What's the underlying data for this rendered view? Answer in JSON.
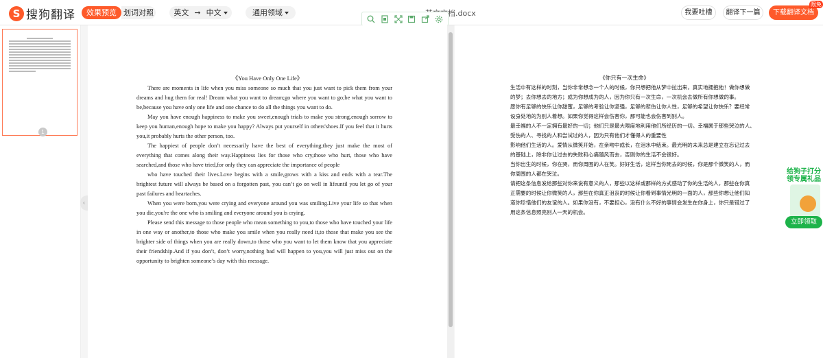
{
  "header": {
    "logo_text": "搜狗翻译",
    "tab_preview": "效果预览",
    "tab_compare": "划词对照",
    "source_lang": "英文",
    "target_lang": "中文",
    "domain_select": "通用领域",
    "file_name": "英文文档.docx",
    "feedback_button": "我要吐槽",
    "next_button": "翻译下一篇",
    "download_button": "下载翻译文档",
    "free_badge": "限免"
  },
  "toolbar_icons": [
    "zoom-icon",
    "fit-page-icon",
    "fullscreen-icon",
    "save-icon",
    "export-icon",
    "settings-icon"
  ],
  "thumbnails": {
    "page_number": "1"
  },
  "source_doc": {
    "title": "《You Have Only One Life》",
    "paragraphs": [
      "There are moments in life when you miss someone so much that you just want to pick them from your dreams and hug them for real! Dream what you want to dream;go where you want to go;be what you want to be,because you have only one life and one chance to do all the things you want to do.",
      "May you have enough happiness to make you sweet,enough trials to make you strong,enough sorrow to keep you human,enough hope to make you happy? Always put yourself in others'shoes.If you feel that it hurts you,it probably hurts the other person, too.",
      "The happiest of people don’t necessarily have the best of everything;they just make the most of everything that comes along their way.Happiness lies for those who cry,those who hurt, those who have searched,and those who have tried,for only they can appreciate the importance of people",
      "who have touched their lives.Love begins with a smile,grows with a kiss and ends with a tear.The brightest future will always be based on a forgotten past, you can’t go on well in lifeuntil you let go of your past failures and heartaches.",
      "When you were born,you were crying and everyone around you was smiling.Live your life so that when you die,you're the one who is smiling and everyone around you is crying.",
      "Please send this message to those people who mean something to you,to those who have touched your life in one way or another,to those who make you smile when you really need it,to those that make you see the brighter side of things when you are really down,to those who you want to let them know that you appreciate their friendship.And if you don’t, don’t worry,nothing bad will happen to you,you will just miss out on the opportunity to brighten someone’s day with this message."
    ]
  },
  "target_doc": {
    "title": "《你只有一次生命》",
    "lines": [
      "生活中有这样的时刻，当你非常想念一个人的时候，你只想把他从梦中拉出来，真实地拥抱他！做你想做",
      "的梦；去你想去的地方；成为你想成为的人，因为你只有一次生命，一次机会去做所有你想做的事。",
      "愿你有足够的快乐让你甜蜜，足够的考验让你坚强，足够的悲伤让你人性，足够的希望让你快乐？要经常",
      "设身处地的为别人着想。如果你觉得这样会伤害你，那可能也会伤害到别人。",
      "最幸福的人不一定拥有最好的一切；他们只是最大限度地利用他们所经历的一切。幸福属于那些哭泣的人、",
      "受伤的人、寻找的人和尝试过的人，因为只有他们才懂得人的重要性",
      "影响他们生活的人。爱情从微笑开始，在亲吻中成长，在泪水中结束。最光明的未来总是建立在忘记过去",
      "的基础上，除非你让过去的失败和心痛随风而去，否则你的生活不会很好。",
      "当你出生的时候，你在哭，而你周围的人在笑。好好生活，这样当你死去的时候，你是那个微笑的人，而",
      "你周围的人都在哭泣。",
      "请把这条信息发给那些对你来说有意义的人，那些以这样或那样的方式感动了你的生活的人，那些在你真",
      "正需要的时候让你微笑的人，那些在你真正沮丧的时候让你看到事情光明的一面的人，那些你想让他们知",
      "道你珍惜他们的友谊的人。如果你没有，不要担心，没有什么不好的事情会发生在你身上，你只是错过了",
      "用这条信息照亮别人一天的机会。"
    ]
  },
  "promo": {
    "text_line1": "给狗子打分",
    "text_line2": "领专属礼品",
    "button": "立即领取"
  },
  "colors": {
    "accent": "#fe5a2a",
    "promo_green": "#1db34a",
    "toolbar_green": "#5aaa6a"
  }
}
